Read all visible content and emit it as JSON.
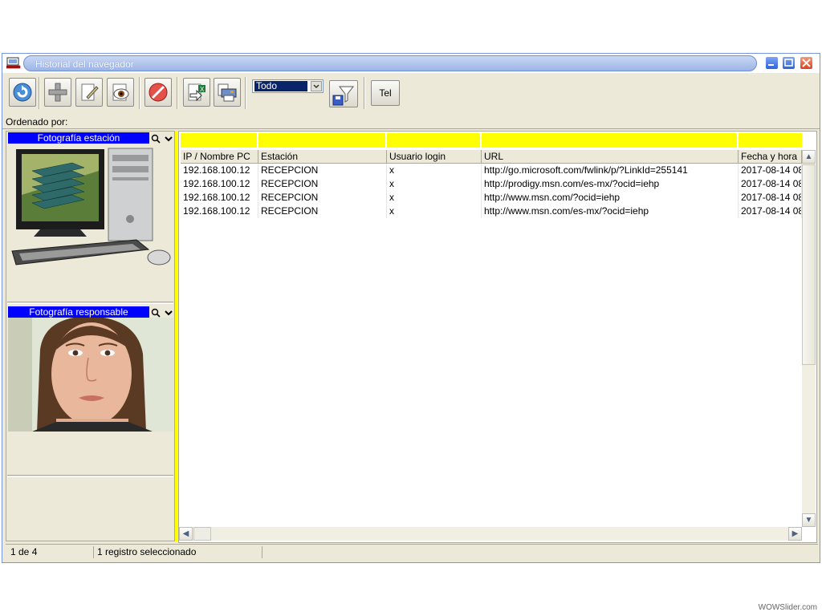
{
  "window": {
    "title": "Historial del navegador"
  },
  "toolbar": {
    "buttons": [
      {
        "name": "refresh-icon"
      },
      {
        "name": "add-icon"
      },
      {
        "name": "edit-icon"
      },
      {
        "name": "view-icon"
      },
      {
        "name": "delete-icon"
      },
      {
        "name": "export-excel-icon"
      },
      {
        "name": "print-icon"
      },
      {
        "name": "filter-save-icon"
      }
    ],
    "filter_value": "Todo",
    "tel_label": "Tel"
  },
  "sort_label": "Ordenado por:",
  "left_panel": {
    "station_photo_label": "Fotografía estación",
    "responsible_photo_label": "Fotografía responsable"
  },
  "grid": {
    "columns": [
      "IP / Nombre PC",
      "Estación",
      "Usuario login",
      "URL",
      "Fecha y hora"
    ],
    "rows": [
      [
        "192.168.100.12",
        "RECEPCION",
        "x",
        "http://go.microsoft.com/fwlink/p/?LinkId=255141",
        "2017-08-14 08:"
      ],
      [
        "192.168.100.12",
        "RECEPCION",
        "x",
        "http://prodigy.msn.com/es-mx/?ocid=iehp",
        "2017-08-14 08:"
      ],
      [
        "192.168.100.12",
        "RECEPCION",
        "x",
        "http://www.msn.com/?ocid=iehp",
        "2017-08-14 08:"
      ],
      [
        "192.168.100.12",
        "RECEPCION",
        "x",
        "http://www.msn.com/es-mx/?ocid=iehp",
        "2017-08-14 08:"
      ]
    ]
  },
  "status": {
    "position": "1 de 4",
    "selection": "1 registro seleccionado"
  },
  "watermark": "WOWSlider.com",
  "colors": {
    "filter_highlight": "#ffff00",
    "photo_header": "#0000ff"
  }
}
